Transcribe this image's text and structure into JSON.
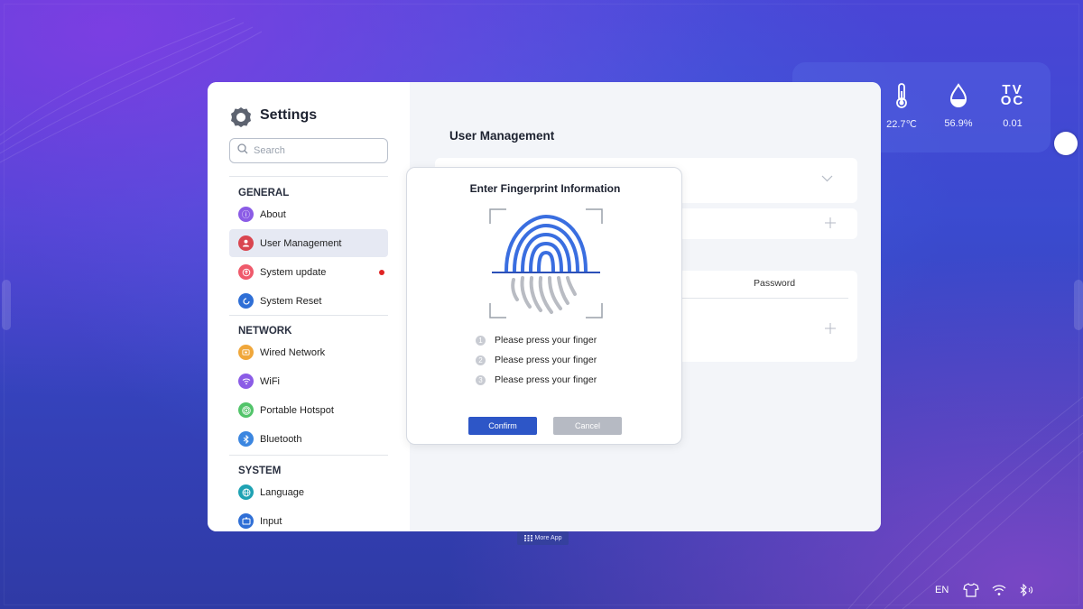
{
  "settings": {
    "title": "Settings",
    "search_placeholder": "Search",
    "sections": [
      {
        "title": "GENERAL",
        "items": [
          {
            "label": "About",
            "icon": "info-icon",
            "color": "#8b5ce6"
          },
          {
            "label": "User Management",
            "icon": "user-icon",
            "color": "#d9454f",
            "active": true
          },
          {
            "label": "System update",
            "icon": "update-icon",
            "color": "#ef5a6b",
            "badge": true
          },
          {
            "label": "System Reset",
            "icon": "reset-icon",
            "color": "#2f6fd6"
          }
        ]
      },
      {
        "title": "NETWORK",
        "items": [
          {
            "label": "Wired Network",
            "icon": "wired-network-icon",
            "color": "#f0a73b"
          },
          {
            "label": "WiFi",
            "icon": "wifi-icon",
            "color": "#8b5ce6"
          },
          {
            "label": "Portable Hotspot",
            "icon": "hotspot-icon",
            "color": "#52c46a"
          },
          {
            "label": "Bluetooth",
            "icon": "bluetooth-icon",
            "color": "#3b86e0"
          }
        ]
      },
      {
        "title": "SYSTEM",
        "items": [
          {
            "label": "Language",
            "icon": "language-icon",
            "color": "#1fa2b3"
          },
          {
            "label": "Input",
            "icon": "input-icon",
            "color": "#2f6fd6"
          }
        ]
      }
    ]
  },
  "main": {
    "page_title": "User Management",
    "table_column": "Password"
  },
  "dialog": {
    "title": "Enter Fingerprint Information",
    "steps": [
      {
        "num": "1",
        "text": "Please press your finger"
      },
      {
        "num": "2",
        "text": "Please press your finger"
      },
      {
        "num": "3",
        "text": "Please press your finger"
      }
    ],
    "confirm_label": "Confirm",
    "cancel_label": "Cancel"
  },
  "sensors": [
    {
      "name": "temperature",
      "icon": "thermometer-icon",
      "value": "22.7℃"
    },
    {
      "name": "humidity",
      "icon": "water-drop-icon",
      "value": "56.9%"
    },
    {
      "name": "tvoc",
      "icon": "tvoc-icon",
      "value": "0.01",
      "glyph_top": "TV",
      "glyph_bottom": "OC"
    }
  ],
  "taskbar": {
    "more_app_label": "More App",
    "language": "EN"
  },
  "colors": {
    "accent": "#2d56c7",
    "fingerprint_blue": "#3a6ee0",
    "fingerprint_gray": "#b9bcc3",
    "badge_red": "#e02424"
  }
}
